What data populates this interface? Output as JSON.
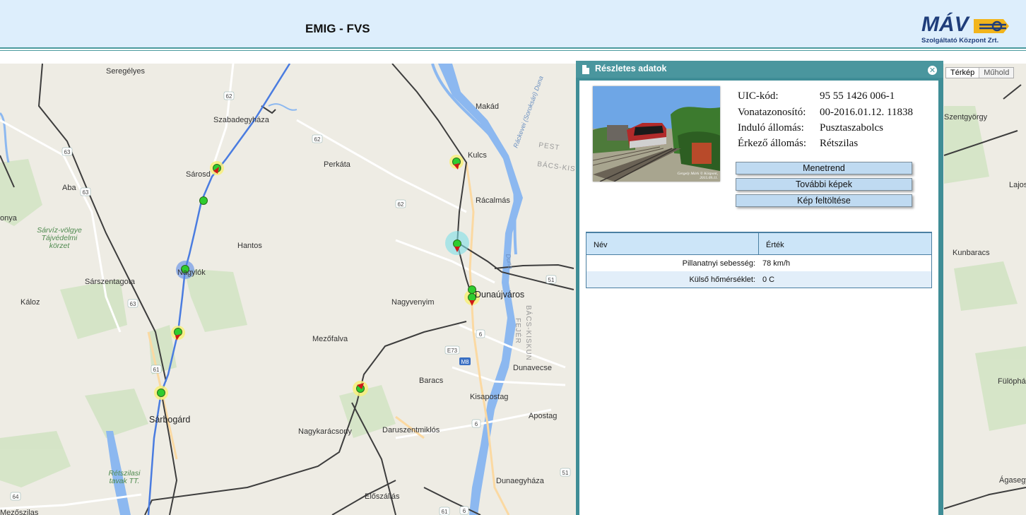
{
  "header": {
    "title": "EMIG - FVS",
    "logo_text": "MÁV",
    "logo_subtitle": "Szolgáltató Központ Zrt."
  },
  "map": {
    "type_toggle": {
      "map_label": "Térkép",
      "satellite_label": "Műhold",
      "selected": "Térkép"
    },
    "places": [
      "Seregélyes",
      "Szabadegyháza",
      "Makád",
      "Kulcs",
      "Sárosd",
      "Perkáta",
      "Rácalmás",
      "Aba",
      "Sárvíz-völgye Tájvédelmi körzet",
      "Hantos",
      "Nagylók",
      "Sárszentagota",
      "Káloz",
      "Nagyvenyim",
      "Dunaújváros",
      "Mezőfalva",
      "Baracs",
      "Dunavecse",
      "Kisapostag",
      "Apostag",
      "Sárbogárd",
      "Nagykarácsony",
      "Daruszentmiklós",
      "Rétszilasi tavak TT.",
      "Dunaegyháza",
      "Előszállás",
      "Mezőszilas",
      "Kunbaracs",
      "Fülöpháza",
      "Ágasegyháza",
      "Lajosmizse",
      "Szentgyörgy",
      "Ráckevei (Soroksári) Duna",
      "Duna",
      "PEST",
      "BÁCS-KISKUN",
      "FEJÉR",
      "onya"
    ],
    "road_shields": [
      "62",
      "62",
      "62",
      "63",
      "63",
      "63",
      "61",
      "6",
      "6",
      "6",
      "51",
      "51",
      "61",
      "64",
      "E73",
      "M8"
    ]
  },
  "panel": {
    "title": "Részletes adatok",
    "photo_caption": "Gergely Márk © Központ, 2015.09.11.",
    "info": [
      {
        "label": "UIC-kód:",
        "value": "95 55 1426 006-1"
      },
      {
        "label": "Vonatazonosító:",
        "value": "00-2016.01.12. 11838"
      },
      {
        "label": "Induló állomás:",
        "value": "Pusztaszabolcs"
      },
      {
        "label": "Érkező állomás:",
        "value": "Rétszilas"
      }
    ],
    "buttons": {
      "timetable": "Menetrend",
      "more_photos": "További képek",
      "upload_photo": "Kép feltöltése"
    },
    "table": {
      "headers": {
        "name": "Név",
        "value": "Érték"
      },
      "rows": [
        {
          "name": "Pillanatnyi sebesség:",
          "value": "78 km/h"
        },
        {
          "name": "Külső hőmérséklet:",
          "value": "0 C"
        }
      ]
    }
  }
}
